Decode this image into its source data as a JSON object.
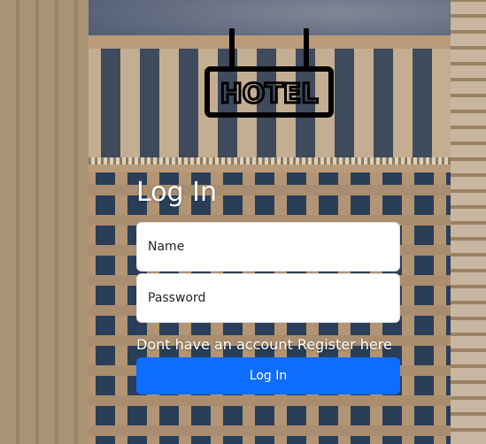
{
  "logo": {
    "text": "HOTEL",
    "icon": "hotel-sign-icon"
  },
  "form": {
    "title": "Log In",
    "name_placeholder": "Name",
    "password_placeholder": "Password",
    "register_text": "Dont have an account Register here",
    "submit_label": "Log In"
  },
  "colors": {
    "primary_button": "#0d6efd",
    "text_light": "#ffffff"
  }
}
